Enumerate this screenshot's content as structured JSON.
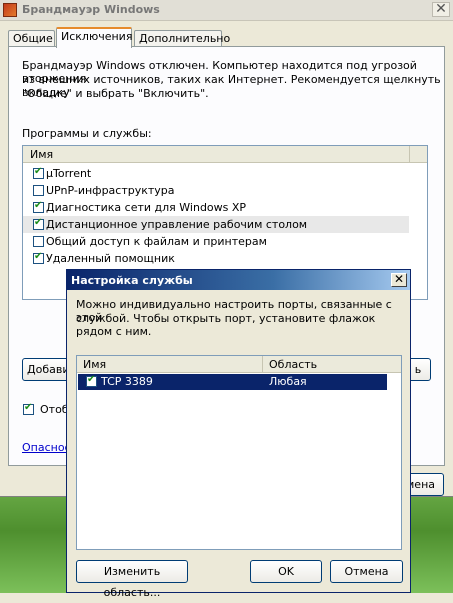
{
  "window": {
    "title": "Брандмауэр Windows",
    "close_glyph": "✕"
  },
  "tabs": [
    {
      "label": "Общие"
    },
    {
      "label": "Исключения"
    },
    {
      "label": "Дополнительно"
    }
  ],
  "info": {
    "line1": "Брандмауэр Windows отключен. Компьютер находится под угрозой вторжения",
    "line2": "из внешних источников, таких как Интернет. Рекомендуется щелкнуть вкладку",
    "line3": "\"Общие\" и выбрать \"Включить\"."
  },
  "programs": {
    "label": "Программы и службы:",
    "column": "Имя",
    "items": [
      {
        "label": "µTorrent",
        "checked": true
      },
      {
        "label": "UPnP-инфраструктура",
        "checked": false
      },
      {
        "label": "Диагностика сети для Windows XP",
        "checked": true
      },
      {
        "label": "Дистанционное управление рабочим столом",
        "checked": true
      },
      {
        "label": "Общий доступ к файлам и принтерам",
        "checked": false
      },
      {
        "label": "Удаленный помощник",
        "checked": true
      }
    ]
  },
  "bg_partial": {
    "add_button": "Добави",
    "notify_checkbox": "Отоб",
    "danger_link": "Опаснос",
    "ok_button_fragment": "мена",
    "right_fragment": "ь"
  },
  "dialog": {
    "title": "Настройка службы",
    "close_glyph": "✕",
    "text1": "Можно индивидуально настроить порты, связанные с этой",
    "text2": "службой. Чтобы открыть порт, установите флажок рядом с ним.",
    "columns": {
      "name": "Имя",
      "scope": "Область"
    },
    "rows": [
      {
        "name": "TCP 3389",
        "scope": "Любая",
        "checked": true
      }
    ],
    "buttons": {
      "change_scope": "Изменить область...",
      "ok": "OK",
      "cancel": "Отмена"
    }
  }
}
